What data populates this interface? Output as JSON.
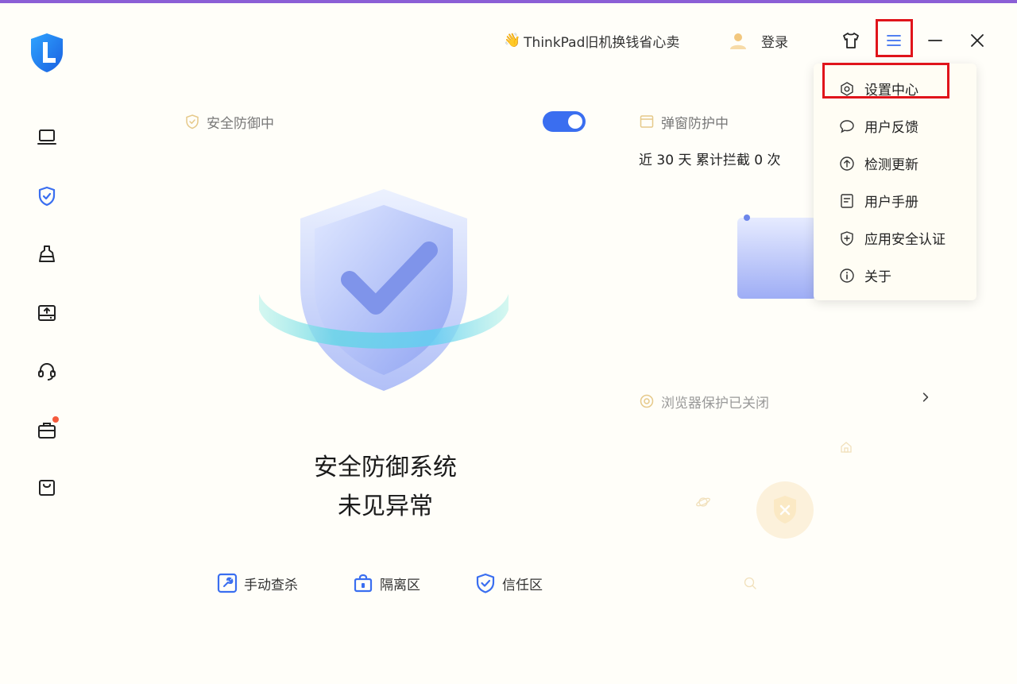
{
  "header": {
    "promo_emoji": "👋",
    "promo_text": "ThinkPad旧机换钱省心卖",
    "login_label": "登录"
  },
  "sidebar": {
    "items": [
      {
        "icon": "laptop-icon"
      },
      {
        "icon": "shield-check-icon",
        "active": true
      },
      {
        "icon": "broom-icon"
      },
      {
        "icon": "drive-upload-icon"
      },
      {
        "icon": "headset-icon"
      },
      {
        "icon": "toolbox-icon",
        "badge": true
      },
      {
        "icon": "shopping-bag-icon"
      }
    ]
  },
  "menu": {
    "items": [
      {
        "icon": "hexagon-settings-icon",
        "label": "设置中心",
        "highlighted": true
      },
      {
        "icon": "chat-bubble-icon",
        "label": "用户反馈"
      },
      {
        "icon": "arrow-up-circle-icon",
        "label": "检测更新"
      },
      {
        "icon": "document-icon",
        "label": "用户手册"
      },
      {
        "icon": "shield-plus-icon",
        "label": "应用安全认证"
      },
      {
        "icon": "info-circle-icon",
        "label": "关于"
      }
    ]
  },
  "security": {
    "label": "安全防御中",
    "toggle_on": true,
    "status_line1": "安全防御系统",
    "status_line2": "未见异常"
  },
  "quick_actions": [
    {
      "icon": "wrench-icon",
      "label": "手动查杀"
    },
    {
      "icon": "lock-box-icon",
      "label": "隔离区"
    },
    {
      "icon": "shield-check-icon",
      "label": "信任区"
    }
  ],
  "popup_protection": {
    "label": "弹窗防护中",
    "stat": "近 30 天 累计拦截 0 次"
  },
  "browser_protection": {
    "label": "浏览器保护已关闭"
  },
  "colors": {
    "accent": "#3a6ef0",
    "highlight_box": "#e0141b",
    "top_stripe": "#8b5fd6",
    "background": "#fffef9"
  }
}
